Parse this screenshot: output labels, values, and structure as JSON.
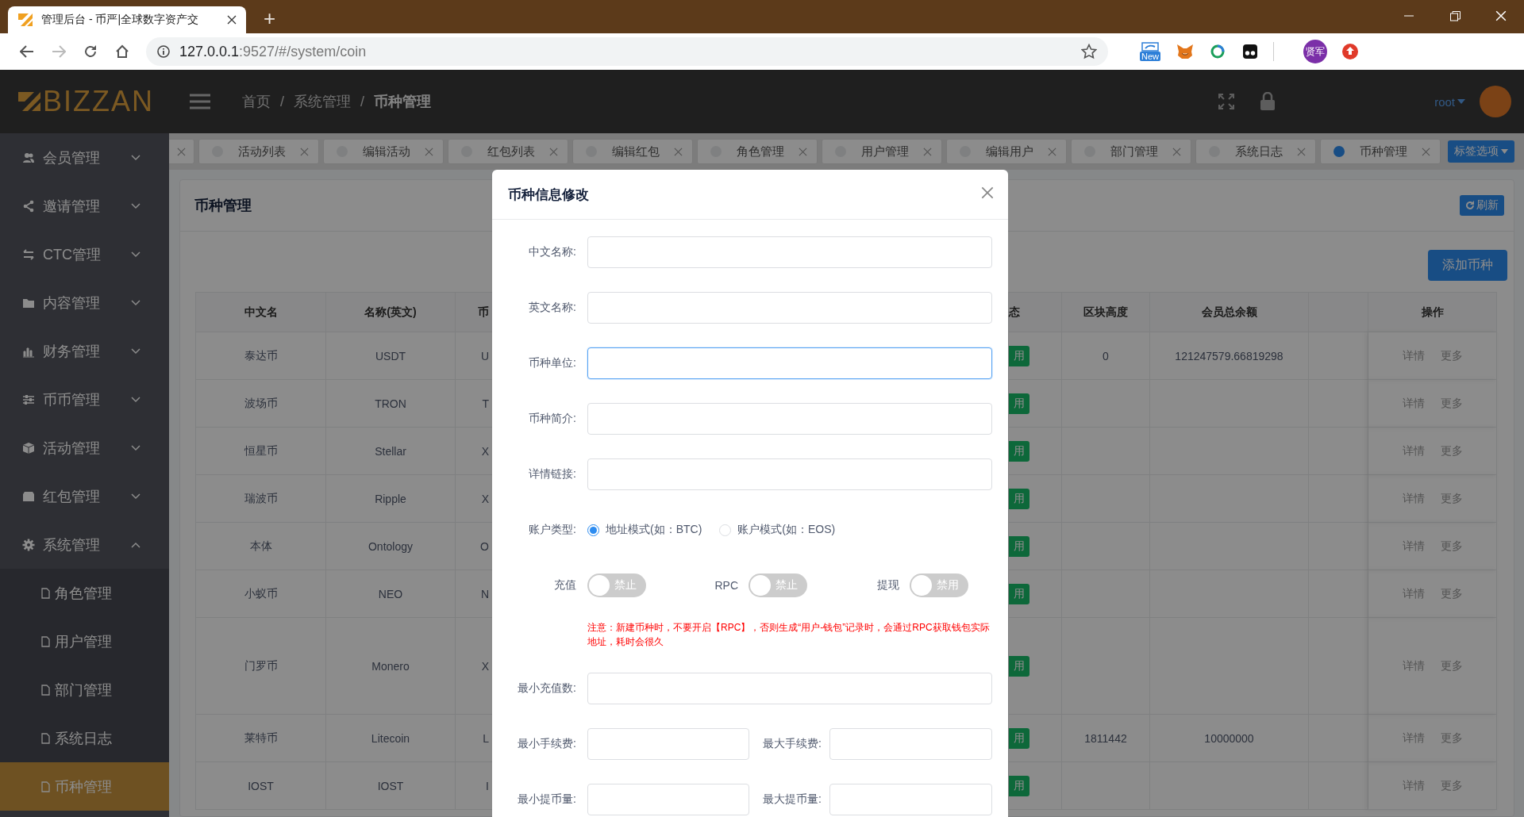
{
  "browser": {
    "tab_title": "管理后台 - 币严|全球数字资产交",
    "new_tab": "+",
    "url_host": "127.0.0.1",
    "url_rest": ":9527/#/system/coin",
    "extensions": [
      {
        "kind": "new",
        "label": "New"
      },
      {
        "kind": "fox"
      },
      {
        "kind": "ring"
      },
      {
        "kind": "mask"
      },
      {
        "kind": "avatar",
        "label": "贤军"
      },
      {
        "kind": "upload"
      }
    ]
  },
  "header": {
    "logo": "BIZZAN",
    "separator": "/",
    "breadcrumb": [
      {
        "label": "首页",
        "current": false
      },
      {
        "label": "系统管理",
        "current": false
      },
      {
        "label": "币种管理",
        "current": true
      }
    ],
    "user": "root"
  },
  "sidebar": {
    "items": [
      {
        "label": "会员管理",
        "kind": "users",
        "expanded": false
      },
      {
        "label": "邀请管理",
        "kind": "share",
        "expanded": false
      },
      {
        "label": "CTC管理",
        "kind": "exchange",
        "expanded": false
      },
      {
        "label": "内容管理",
        "kind": "folder",
        "expanded": false
      },
      {
        "label": "财务管理",
        "kind": "chart",
        "expanded": false
      },
      {
        "label": "币币管理",
        "kind": "sliders",
        "expanded": false
      },
      {
        "label": "活动管理",
        "kind": "cube",
        "expanded": false
      },
      {
        "label": "红包管理",
        "kind": "wallet",
        "expanded": false
      },
      {
        "label": "系统管理",
        "kind": "gear",
        "expanded": true,
        "children": [
          {
            "label": "角色管理",
            "selected": false
          },
          {
            "label": "用户管理",
            "selected": false
          },
          {
            "label": "部门管理",
            "selected": false
          },
          {
            "label": "系统日志",
            "selected": false
          },
          {
            "label": "币种管理",
            "selected": true
          }
        ]
      }
    ]
  },
  "tags": [
    {
      "label": "活动列表",
      "selected": false
    },
    {
      "label": "编辑活动",
      "selected": false
    },
    {
      "label": "红包列表",
      "selected": false
    },
    {
      "label": "编辑红包",
      "selected": false
    },
    {
      "label": "角色管理",
      "selected": false
    },
    {
      "label": "用户管理",
      "selected": false
    },
    {
      "label": "编辑用户",
      "selected": false
    },
    {
      "label": "部门管理",
      "selected": false
    },
    {
      "label": "系统日志",
      "selected": false
    },
    {
      "label": "币种管理",
      "selected": true
    }
  ],
  "tag_options": "标签选项",
  "page": {
    "title": "币种管理",
    "refresh": "刷新",
    "add_button": "添加币种"
  },
  "table": {
    "columns": [
      "中文名",
      "名称(英文)",
      "币",
      "态",
      "区块高度",
      "会员总余额",
      "操作"
    ],
    "rows": [
      {
        "cells": [
          "泰达币",
          "USDT",
          "U",
          "用",
          "0",
          "121247579.66819298"
        ],
        "actions": [
          "详情",
          "更多"
        ]
      },
      {
        "cells": [
          "波场币",
          "TRON",
          "T",
          "用",
          "",
          ""
        ],
        "actions": [
          "详情",
          "更多"
        ]
      },
      {
        "cells": [
          "恒星币",
          "Stellar",
          "X",
          "用",
          "",
          ""
        ],
        "actions": [
          "详情",
          "更多"
        ]
      },
      {
        "cells": [
          "瑞波币",
          "Ripple",
          "X",
          "用",
          "",
          ""
        ],
        "actions": [
          "详情",
          "更多"
        ]
      },
      {
        "cells": [
          "本体",
          "Ontology",
          "O",
          "用",
          "",
          ""
        ],
        "actions": [
          "详情",
          "更多"
        ]
      },
      {
        "cells": [
          "小蚁币",
          "NEO",
          "N",
          "用",
          "",
          ""
        ],
        "actions": [
          "详情",
          "更多"
        ]
      },
      {
        "cells": [
          "门罗币",
          "Monero",
          "X",
          "用",
          "",
          ""
        ],
        "actions": [
          "详情",
          "更多"
        ]
      },
      {
        "cells": [
          "莱特币",
          "Litecoin",
          "L",
          "用",
          "1811442",
          "10000000"
        ],
        "actions": [
          "详情",
          "更多"
        ]
      },
      {
        "cells": [
          "IOST",
          "IOST",
          "I",
          "用",
          "",
          ""
        ],
        "actions": [
          "详情",
          "更多"
        ]
      }
    ]
  },
  "modal": {
    "title": "币种信息修改",
    "fields": [
      {
        "label": "中文名称:",
        "focused": false
      },
      {
        "label": "英文名称:",
        "focused": false
      },
      {
        "label": "币种单位:",
        "focused": true
      },
      {
        "label": "币种简介:",
        "focused": false
      },
      {
        "label": "详情链接:",
        "focused": false
      }
    ],
    "account_type": {
      "label": "账户类型:",
      "options": [
        {
          "label": "地址模式(如：BTC)",
          "selected": true
        },
        {
          "label": "账户模式(如：EOS)",
          "selected": false
        }
      ]
    },
    "switches": [
      {
        "label": "充值",
        "on": false,
        "text": "禁止"
      },
      {
        "label": "RPC",
        "on": false,
        "text": "禁止"
      },
      {
        "label": "提现",
        "on": false,
        "text": "禁用"
      }
    ],
    "warning": "注意：新建币种时，不要开启【RPC】，否则生成“用户-钱包”记录时，会通过RPC获取钱包实际地址，耗时会很久",
    "more_fields": [
      {
        "kind": "full",
        "label": "最小充值数:"
      },
      {
        "kind": "pair",
        "labels": [
          "最小手续费:",
          "最大手续费:"
        ]
      },
      {
        "kind": "pair",
        "labels": [
          "最小提币量:",
          "最大提币量:"
        ]
      }
    ]
  }
}
